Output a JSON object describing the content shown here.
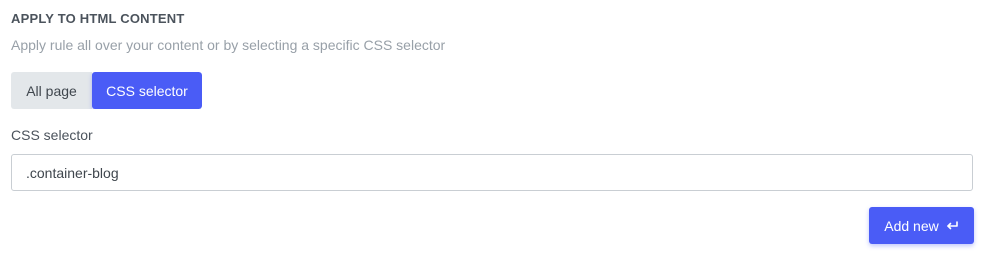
{
  "section": {
    "title": "APPLY TO HTML CONTENT",
    "description": "Apply rule all over your content or by selecting a specific CSS selector"
  },
  "toggle": {
    "options": [
      "All page",
      "CSS selector"
    ],
    "selected": "CSS selector"
  },
  "css_selector_field": {
    "label": "CSS selector",
    "value": ".container-blog",
    "placeholder": ""
  },
  "add_button": {
    "label": "Add new",
    "icon": "return-arrow-icon"
  },
  "colors": {
    "accent": "#4a5cf6",
    "inactive_bg": "#e3e7ea",
    "title_text": "#4b535c",
    "muted_text": "#98a0a8"
  }
}
